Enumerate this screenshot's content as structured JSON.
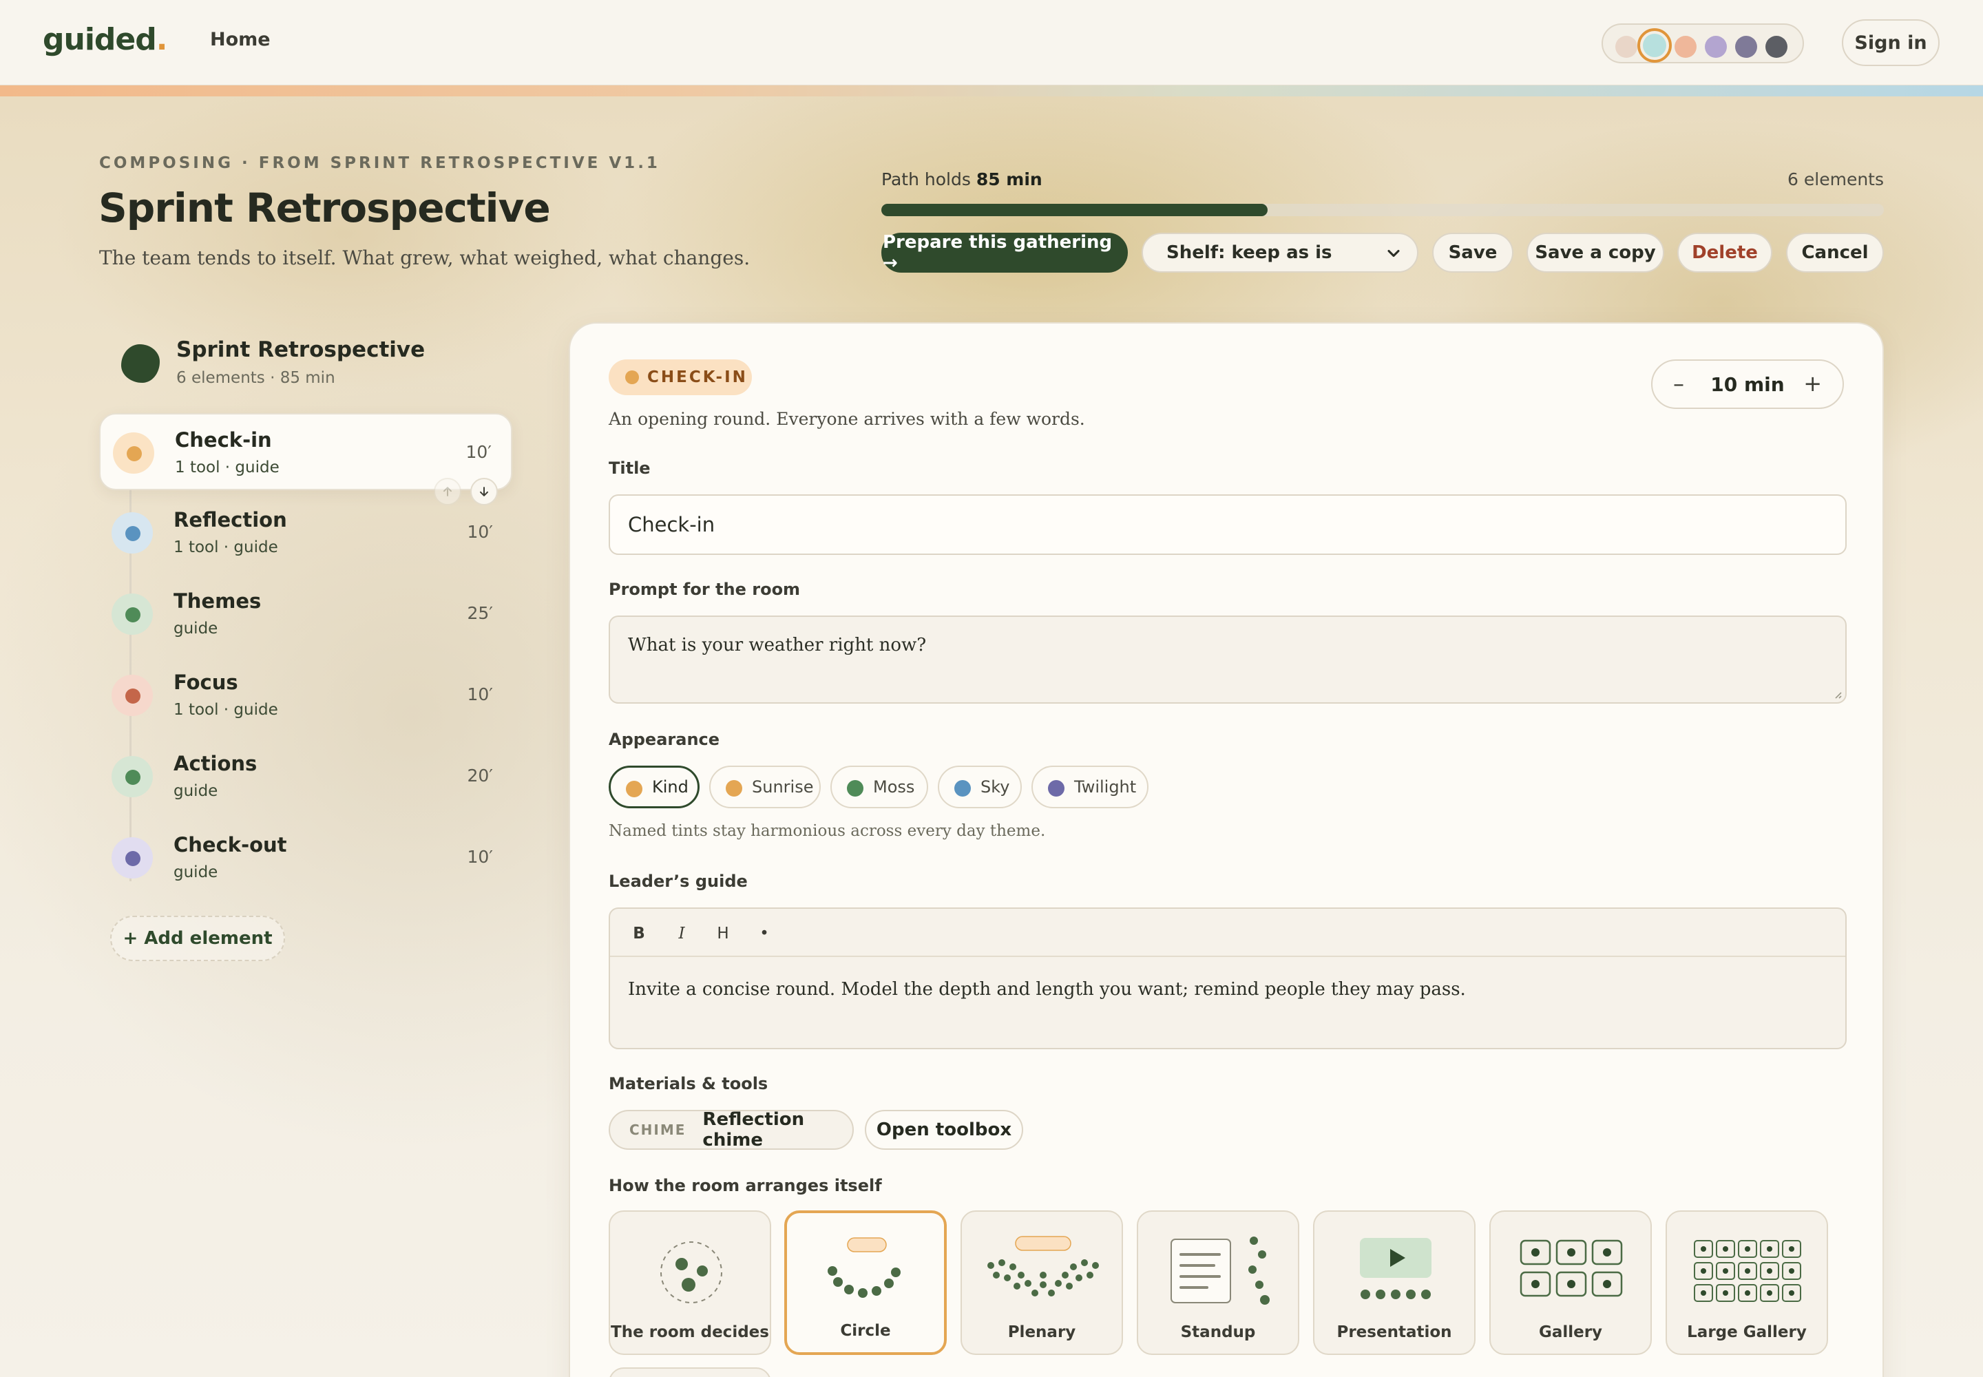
{
  "topbar": {
    "logo": "guided",
    "logo_dot": ".",
    "nav_home": "Home",
    "sign_in": "Sign in",
    "theme_swatches": [
      "#e9d6c8",
      "#b7e0de",
      "#efb79a",
      "#b3a5d0",
      "#7f7a98",
      "#5c5e64"
    ],
    "active_swatch_index": 1
  },
  "header": {
    "eyebrow": "COMPOSING · FROM SPRINT RETROSPECTIVE V1.1",
    "title": "Sprint Retrospective",
    "subtitle": "The team tends to itself. What grew, what weighed, what changes.",
    "path_holds_prefix": "Path holds",
    "path_holds_value": "85 min",
    "elements_count": "6 elements",
    "progress_fraction": 0.385
  },
  "actions": {
    "prepare": "Prepare this gathering →",
    "shelf": "Shelf: keep as is",
    "save": "Save",
    "save_copy": "Save a copy",
    "delete": "Delete",
    "cancel": "Cancel"
  },
  "rail": {
    "title": "Sprint Retrospective",
    "meta": "6 elements · 85 min",
    "add_element": "+ Add element",
    "items": [
      {
        "name": "Check-in",
        "sub": "1 tool · guide",
        "mins": "10′",
        "dot": "#e4a653",
        "halo": "#fbe3c4"
      },
      {
        "name": "Reflection",
        "sub": "1 tool · guide",
        "mins": "10′",
        "dot": "#5a93c0",
        "halo": "#d7e6f0"
      },
      {
        "name": "Themes",
        "sub": "guide",
        "mins": "25′",
        "dot": "#4f8b58",
        "halo": "#d6e6d4"
      },
      {
        "name": "Focus",
        "sub": "1 tool · guide",
        "mins": "10′",
        "dot": "#c4664a",
        "halo": "#f6d8cc"
      },
      {
        "name": "Actions",
        "sub": "guide",
        "mins": "20′",
        "dot": "#4f8b58",
        "halo": "#d6e6d4"
      },
      {
        "name": "Check-out",
        "sub": "guide",
        "mins": "10′",
        "dot": "#6d6aa8",
        "halo": "#e1ddf0"
      }
    ]
  },
  "editor": {
    "kind": "CHECK-IN",
    "duration": "10 min",
    "duration_minus": "–",
    "duration_plus": "+",
    "description": "An opening round. Everyone arrives with a few words.",
    "title_label": "Title",
    "title_value": "Check-in",
    "prompt_label": "Prompt for the room",
    "prompt_value": "What is your weather right now?",
    "appearance_label": "Appearance",
    "tints": [
      {
        "name": "Kind",
        "color": "#e4a653"
      },
      {
        "name": "Sunrise",
        "color": "#e4a653"
      },
      {
        "name": "Moss",
        "color": "#4f8b58"
      },
      {
        "name": "Sky",
        "color": "#5a93c0"
      },
      {
        "name": "Twilight",
        "color": "#6d6aa8"
      }
    ],
    "tint_hint": "Named tints stay harmonious across every day theme.",
    "guide_label": "Leader’s guide",
    "toolbar": {
      "bold": "B",
      "italic": "I",
      "heading": "H",
      "bullet": "•"
    },
    "guide_text": "Invite a concise round. Model the depth and length you want; remind people they may pass.",
    "materials_label": "Materials & tools",
    "tool_tag": "CHIME",
    "tool_name": "Reflection chime",
    "open_toolbox": "Open toolbox",
    "arrange_label": "How the room arranges itself",
    "arrangements": [
      "The room decides",
      "Circle",
      "Plenary",
      "Standup",
      "Presentation",
      "Gallery",
      "Large Gallery"
    ]
  },
  "colors": {
    "accent_green": "#2f4a2c",
    "accent_orange": "#e4a653",
    "danger": "#a0412a"
  }
}
